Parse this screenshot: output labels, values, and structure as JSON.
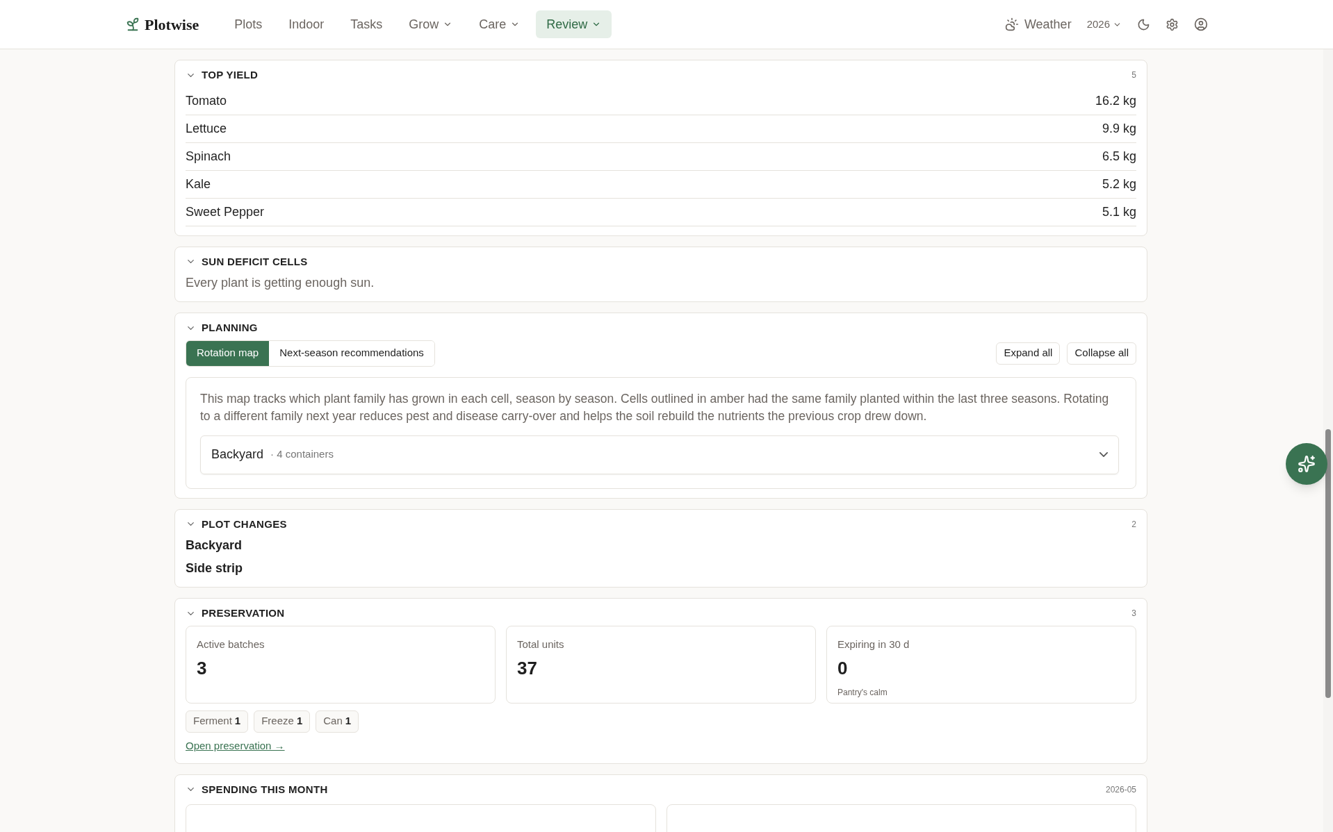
{
  "brand": "Plotwise",
  "nav": [
    {
      "label": "Plots",
      "selected": false,
      "dropdown": false
    },
    {
      "label": "Indoor",
      "selected": false,
      "dropdown": false
    },
    {
      "label": "Tasks",
      "selected": false,
      "dropdown": false
    },
    {
      "label": "Grow",
      "selected": false,
      "dropdown": true
    },
    {
      "label": "Care",
      "selected": false,
      "dropdown": true
    },
    {
      "label": "Review",
      "selected": true,
      "dropdown": true
    }
  ],
  "weather": "Weather",
  "year": "2026",
  "top_yield": {
    "title": "TOP YIELD",
    "count": "5",
    "expanded": true,
    "rows": [
      {
        "name": "Tomato",
        "value": "16.2 kg"
      },
      {
        "name": "Lettuce",
        "value": "9.9 kg"
      },
      {
        "name": "Spinach",
        "value": "6.5 kg"
      },
      {
        "name": "Kale",
        "value": "5.2 kg"
      },
      {
        "name": "Sweet Pepper",
        "value": "5.1 kg"
      }
    ]
  },
  "sun_deficit": {
    "title": "SUN DEFICIT CELLS",
    "expanded": true,
    "message": "Every plant is getting enough sun."
  },
  "planning": {
    "title": "PLANNING",
    "expanded": true,
    "tabs": [
      {
        "label": "Rotation map",
        "selected": true
      },
      {
        "label": "Next-season recommendations",
        "selected": false
      }
    ],
    "buttons": [
      "Expand all",
      "Collapse all"
    ],
    "description": "This map tracks which plant family has grown in each cell, season by season. Cells outlined in amber had the same family planted within the last three seasons. Rotating to a different family next year reduces pest and disease carry-over and helps the soil rebuild the nutrients the previous crop drew down.",
    "plots": [
      {
        "name": "Backyard",
        "meta": "· 4 containers",
        "expanded": false
      }
    ]
  },
  "plot_changes": {
    "title": "PLOT CHANGES",
    "count": "2",
    "expanded": true,
    "items": [
      "Backyard",
      "Side strip"
    ]
  },
  "preservation": {
    "title": "PRESERVATION",
    "count": "3",
    "expanded": true,
    "stats": [
      {
        "label": "Active batches",
        "value": "3"
      },
      {
        "label": "Total units",
        "value": "37"
      },
      {
        "label": "Expiring in 30 d",
        "value": "0",
        "note": "Pantry's calm"
      }
    ],
    "chips": [
      {
        "label": "Ferment",
        "count": "1"
      },
      {
        "label": "Freeze",
        "count": "1"
      },
      {
        "label": "Can",
        "count": "1"
      }
    ],
    "link": "Open preservation →"
  },
  "spending": {
    "title": "SPENDING THIS MONTH",
    "count": "2026-05",
    "expanded": true
  }
}
